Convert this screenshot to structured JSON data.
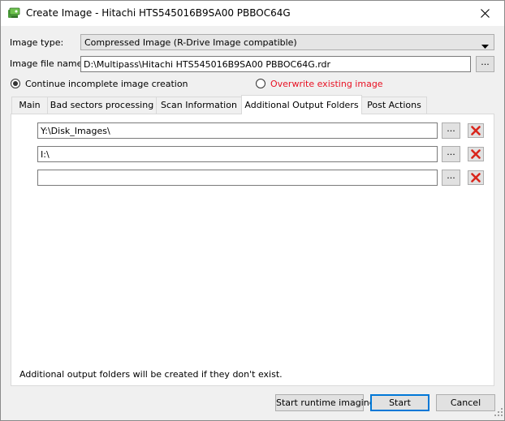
{
  "window": {
    "title": "Create Image - Hitachi HTS545016B9SA00 PBBOC64G"
  },
  "icons": {
    "app": "disk-image-icon",
    "close": "close-icon",
    "browse": "ellipsis",
    "delete": "red-x-icon"
  },
  "image_type": {
    "label": "Image type:",
    "value": "Compressed Image (R-Drive Image compatible)"
  },
  "image_file": {
    "label": "Image file name:",
    "value": "D:\\Multipass\\Hitachi HTS545016B9SA00 PBBOC64G.rdr",
    "browse_label": "..."
  },
  "options": {
    "continue_label": "Continue incomplete image creation",
    "continue_checked": true,
    "overwrite_label": "Overwrite existing image",
    "overwrite_checked": false,
    "overwrite_color": "#e81123"
  },
  "tabs": [
    {
      "label": "Main"
    },
    {
      "label": "Bad sectors processing"
    },
    {
      "label": "Scan Information"
    },
    {
      "label": "Additional Output Folders",
      "active": true
    },
    {
      "label": "Post Actions"
    }
  ],
  "folders": [
    {
      "value": "Y:\\Disk_Images\\",
      "browse_label": "..."
    },
    {
      "value": "I:\\",
      "browse_label": "..."
    },
    {
      "value": "",
      "browse_label": "..."
    }
  ],
  "note": "Additional output folders will be created if they don't exist.",
  "buttons": {
    "runtime": "Start runtime imaging",
    "start": "Start",
    "cancel": "Cancel"
  },
  "colors": {
    "accent": "#0078d7",
    "delete": "#d9261c"
  }
}
